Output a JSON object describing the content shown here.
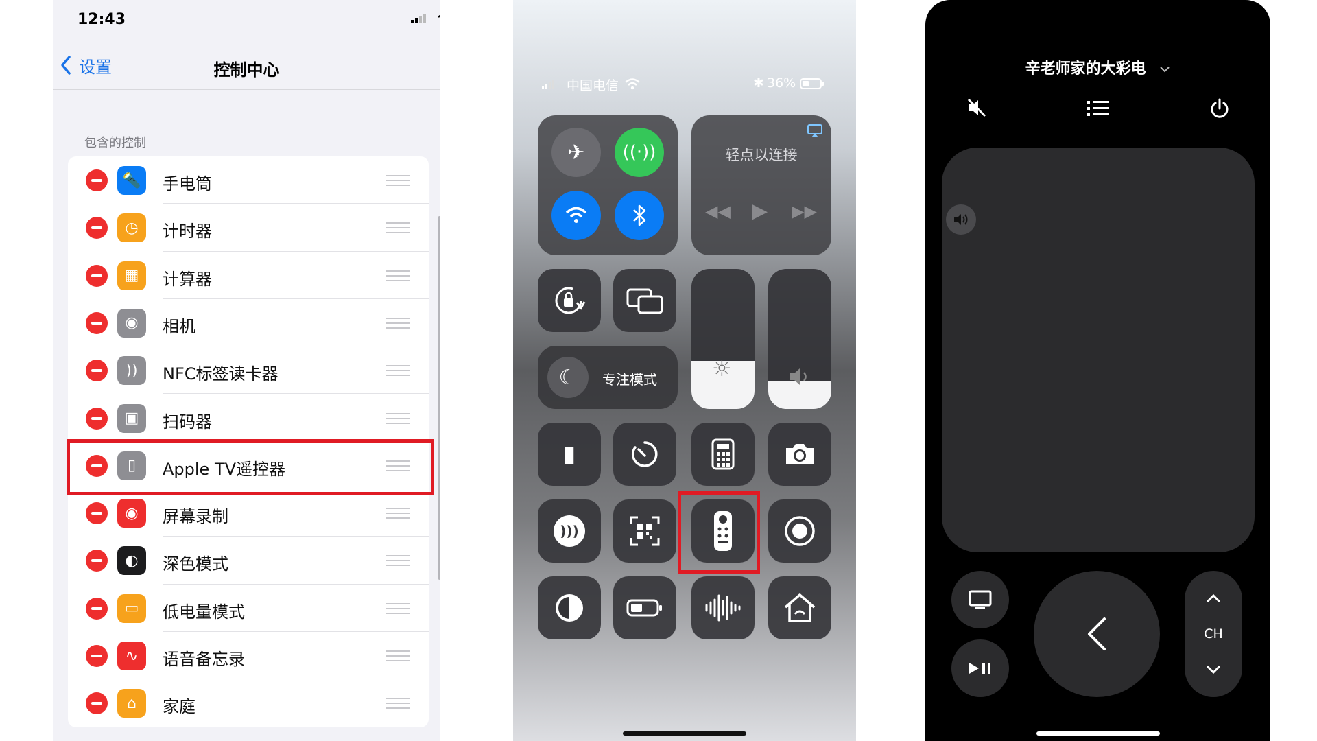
{
  "settings": {
    "status_time": "12:43",
    "back_label": "设置",
    "title": "控制中心",
    "section_header": "包含的控制",
    "items": [
      {
        "label": "手电筒",
        "icon": "flashlight-icon",
        "color": "#0a7cf5",
        "glyph": "🔦"
      },
      {
        "label": "计时器",
        "icon": "timer-icon",
        "color": "#f7a21c",
        "glyph": "◷"
      },
      {
        "label": "计算器",
        "icon": "calculator-icon",
        "color": "#f7a21c",
        "glyph": "▦"
      },
      {
        "label": "相机",
        "icon": "camera-icon",
        "color": "#8e8e93",
        "glyph": "◉"
      },
      {
        "label": "NFC标签读卡器",
        "icon": "nfc-icon",
        "color": "#8e8e93",
        "glyph": "))"
      },
      {
        "label": "扫码器",
        "icon": "qr-scanner-icon",
        "color": "#8e8e93",
        "glyph": "▣"
      },
      {
        "label": "Apple TV遥控器",
        "icon": "apple-tv-remote-icon",
        "color": "#8e8e93",
        "glyph": "▯"
      },
      {
        "label": "屏幕录制",
        "icon": "screen-record-icon",
        "color": "#ee2e2e",
        "glyph": "◉"
      },
      {
        "label": "深色模式",
        "icon": "dark-mode-icon",
        "color": "#1c1c1e",
        "glyph": "◐"
      },
      {
        "label": "低电量模式",
        "icon": "low-power-icon",
        "color": "#f7a21c",
        "glyph": "▭"
      },
      {
        "label": "语音备忘录",
        "icon": "voice-memo-icon",
        "color": "#ee2e2e",
        "glyph": "∿"
      },
      {
        "label": "家庭",
        "icon": "home-icon",
        "color": "#f7a21c",
        "glyph": "⌂"
      }
    ]
  },
  "control_center": {
    "carrier": "中国电信",
    "battery": "36%",
    "media_label": "轻点以连接",
    "focus_label": "专注模式"
  },
  "remote": {
    "device_name": "辛老师家的大彩电",
    "ch_label": "CH"
  }
}
